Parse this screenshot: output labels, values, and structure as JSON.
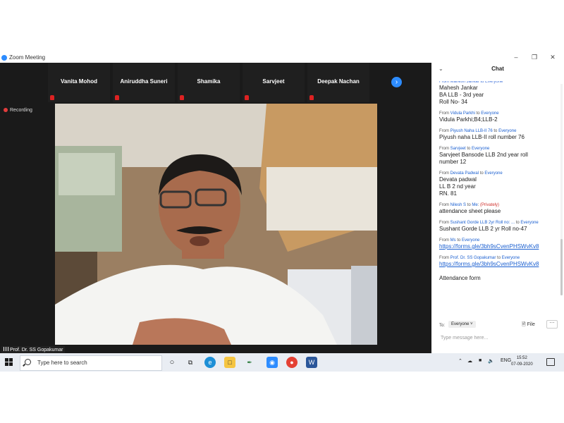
{
  "window": {
    "title": "Zoom Meeting"
  },
  "participants": [
    "Vanita Mohod",
    "Aniruddha Suneri",
    "Shamika",
    "Sarvjeet",
    "Deepak Nachan"
  ],
  "meeting": {
    "recording_label": "Recording",
    "speaker_name": "Prof. Dr. SS Gopakumar"
  },
  "chat": {
    "title": "Chat",
    "partial_line": "From Mahesh Jankar to Everyone",
    "messages": [
      {
        "from": "",
        "to": "",
        "private": "",
        "lines": [
          "Mahesh Jankar",
          "BA LLB - 3rd year",
          "Roll No- 34"
        ]
      },
      {
        "from": "Vidula Parkhi",
        "to": "Everyone",
        "private": "",
        "lines": [
          "Vidula Parkhi;B4;LLB-2"
        ]
      },
      {
        "from": "Piyush Naha LLB-II 76",
        "to": "Everyone",
        "private": "",
        "lines": [
          "Piyush naha LLB-II roll number 76"
        ]
      },
      {
        "from": "Sarvjeet",
        "to": "Everyone",
        "private": "",
        "lines": [
          "Sarvjeet Bansode LLB 2nd year roll",
          "number 12"
        ]
      },
      {
        "from": "Devata Padwal",
        "to": "Everyone",
        "private": "",
        "lines": [
          "Devata padwal",
          "LL B 2 nd year",
          "RN. 81"
        ]
      },
      {
        "from": "Nilesh S",
        "to": "Me",
        "private": "(Privately)",
        "lines": [
          "attendance sheet please"
        ]
      },
      {
        "from": "Sushant Gorde LLB 2yr Roll no: ...",
        "to": "Everyone",
        "private": "",
        "lines": [
          "Sushant Gorde LLB 2 yr Roll no-47"
        ]
      },
      {
        "from": "Ms",
        "to": "Everyone",
        "private": "",
        "lines": [
          "https://forms.gle/3bh9sCvenPHSWvKv8"
        ],
        "link": true
      },
      {
        "from": "Prof. Dr. SS Gopakumar",
        "to": "Everyone",
        "private": "",
        "lines": [
          "https://forms.gle/3bh9sCvenPHSWvKv8",
          "",
          "Attendance form"
        ],
        "link_first": true
      }
    ],
    "to_label": "To:",
    "recipient": "Everyone",
    "file_label": "File",
    "input_placeholder": "Type message here..."
  },
  "taskbar": {
    "search_placeholder": "Type here to search",
    "language": "ENG",
    "time": "15:52",
    "date": "07-09-2020"
  }
}
